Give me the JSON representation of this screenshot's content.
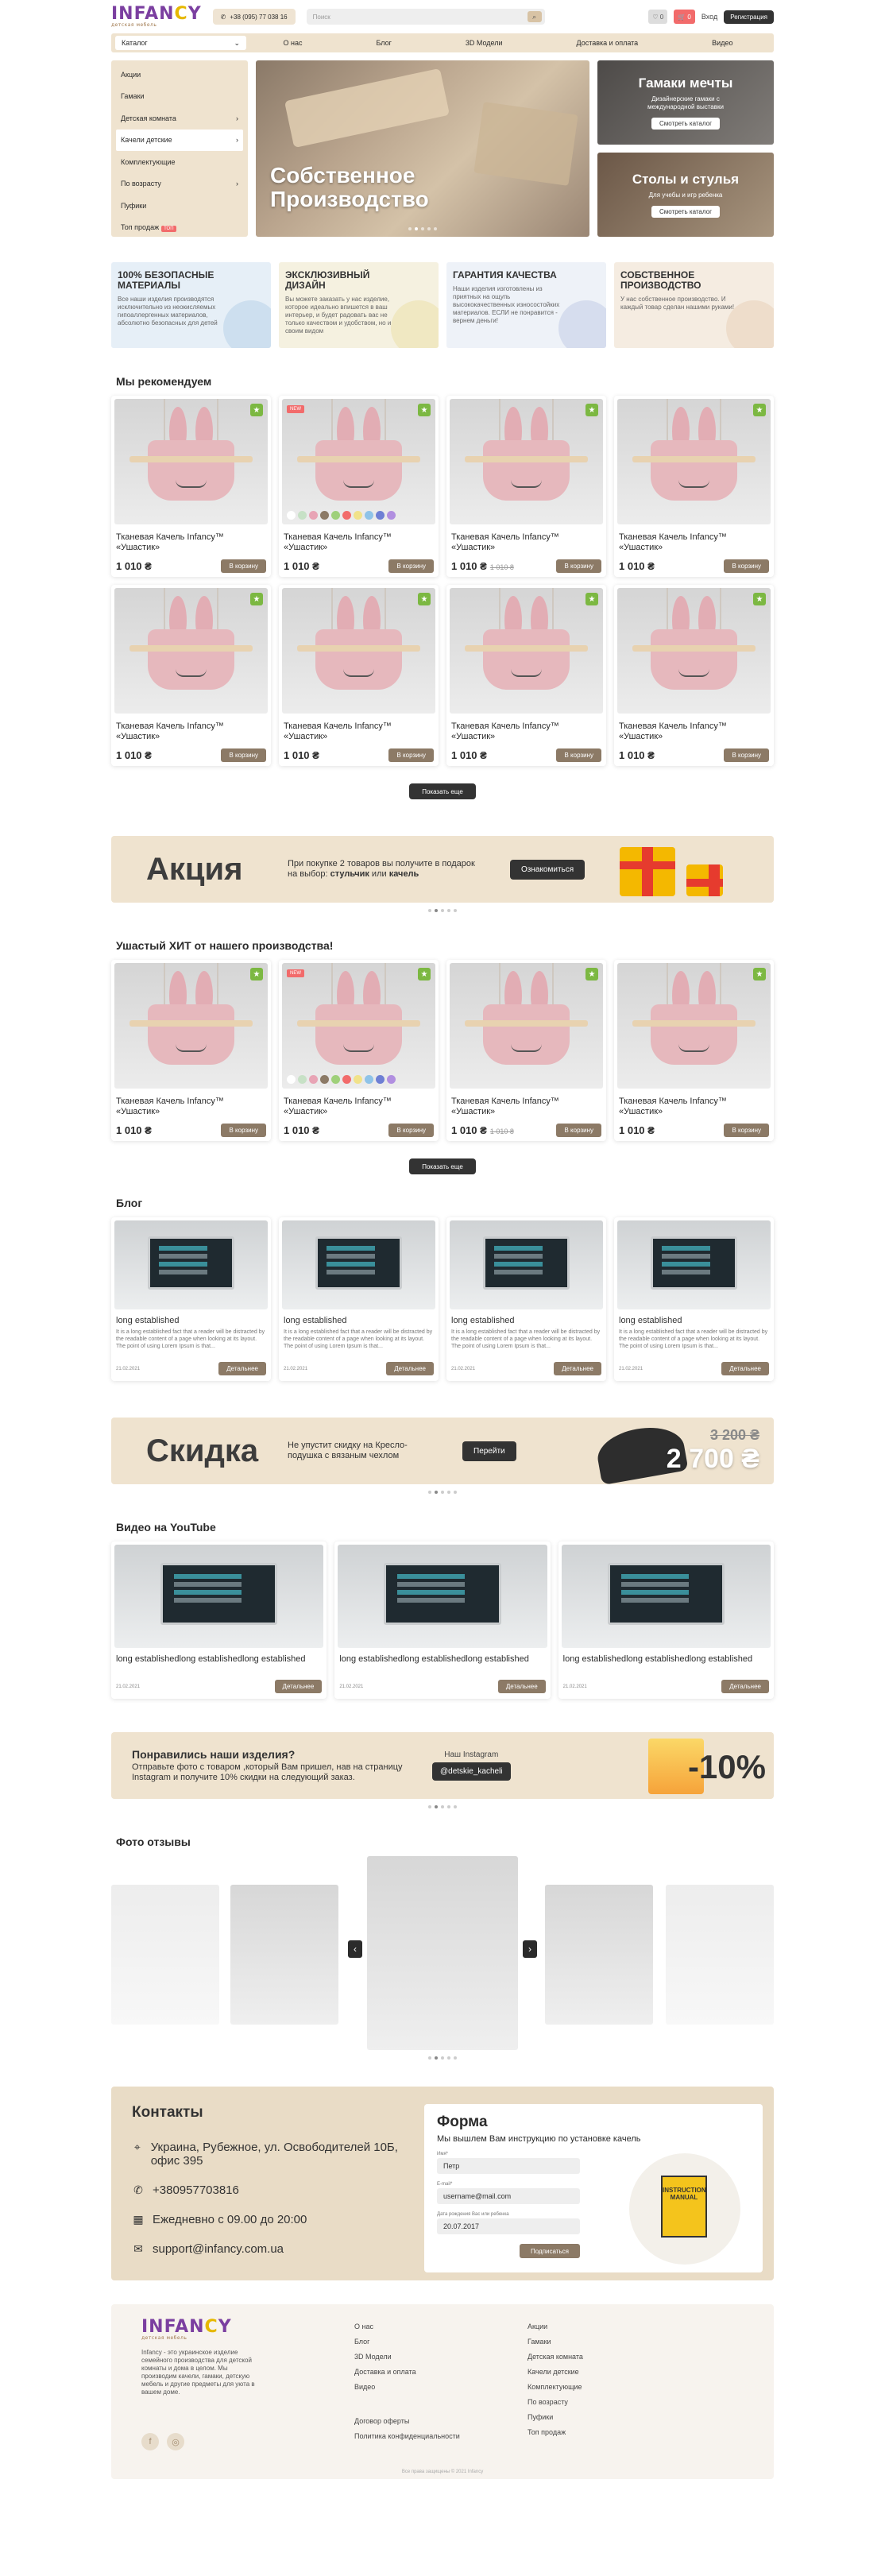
{
  "header": {
    "logo": "INFANCY",
    "logo_sub": "детская мебель",
    "phone": "+38 (095) 77 038 16",
    "search_placeholder": "Поиск",
    "fav_count": "0",
    "cart_count": "0",
    "login": "Вход",
    "register": "Регистрация"
  },
  "nav": {
    "catalog": "Каталог",
    "items": [
      "О нас",
      "Блог",
      "3D Модели",
      "Доставка и оплата",
      "Видео"
    ]
  },
  "sidebar": {
    "items": [
      "Акции",
      "Гамаки",
      "Детская комната",
      "Качели детские",
      "Комплектующие",
      "По возрасту",
      "Пуфики",
      "Топ продаж"
    ],
    "top_badge": "ТОП"
  },
  "hero": {
    "title_line1": "Собственное",
    "title_line2": "Производство",
    "promo1_title": "Гамаки мечты",
    "promo1_text": "Дизайнерские гамаки с международной выставки",
    "promo1_btn": "Смотреть каталог",
    "promo2_title": "Столы и стулья",
    "promo2_text": "Для учебы и игр ребенка",
    "promo2_btn": "Смотреть каталог"
  },
  "features": [
    {
      "title": "100% безопасные материалы",
      "text": "Все наши изделия производятся исключительно из неокисляемых гипоаллергенных материалов, абсолютно безопасных для детей"
    },
    {
      "title": "Эксклюзивный дизайн",
      "text": "Вы можете заказать у нас изделие, которое идеально впишется в ваш интерьер, и будет радовать вас не только качеством и удобством, но и своим видом"
    },
    {
      "title": "Гарантия качества",
      "text": "Наши изделия изготовлены из приятных на ощупь высококачественных износостойких материалов. ЕСЛИ не понравится - вернем деньги!"
    },
    {
      "title": "Собственное производство",
      "text": "У нас собственное производство. И каждый товар сделан нашими руками!"
    }
  ],
  "recommended": {
    "title": "Мы рекомендуем",
    "products": [
      {
        "name": "Тканевая Качель Infancy™ «Ушастик»",
        "price": "1 010 ₴",
        "old": "",
        "new_tag": false,
        "swatches": false
      },
      {
        "name": "Тканевая Качель Infancy™ «Ушастик»",
        "price": "1 010 ₴",
        "old": "",
        "new_tag": true,
        "swatches": true
      },
      {
        "name": "Тканевая Качель Infancy™ «Ушастик»",
        "price": "1 010 ₴",
        "old": "1 010 ₴",
        "new_tag": false,
        "swatches": false
      },
      {
        "name": "Тканевая Качель Infancy™ «Ушастик»",
        "price": "1 010 ₴",
        "old": "",
        "new_tag": false,
        "swatches": false
      },
      {
        "name": "Тканевая Качель Infancy™ «Ушастик»",
        "price": "1 010 ₴",
        "old": "",
        "new_tag": false,
        "swatches": false
      },
      {
        "name": "Тканевая Качель Infancy™ «Ушастик»",
        "price": "1 010 ₴",
        "old": "",
        "new_tag": false,
        "swatches": false
      },
      {
        "name": "Тканевая Качель Infancy™ «Ушастик»",
        "price": "1 010 ₴",
        "old": "",
        "new_tag": false,
        "swatches": false
      },
      {
        "name": "Тканевая Качель Infancy™ «Ушастик»",
        "price": "1 010 ₴",
        "old": "",
        "new_tag": false,
        "swatches": false
      }
    ],
    "cart_btn": "В корзину",
    "more_btn": "Показать еще"
  },
  "promo_action": {
    "title": "Акция",
    "text1": "При покупке 2 товаров вы получите в подарок на выбор:",
    "text_b1": "стульчик",
    "text_or": "или",
    "text_b2": "качель",
    "btn": "Ознакомиться"
  },
  "hit": {
    "title": "Ушастый ХИТ от нашего производства!",
    "products": [
      {
        "name": "Тканевая Качель Infancy™ «Ушастик»",
        "price": "1 010 ₴",
        "old": "",
        "new_tag": false,
        "swatches": false
      },
      {
        "name": "Тканевая Качель Infancy™ «Ушастик»",
        "price": "1 010 ₴",
        "old": "",
        "new_tag": true,
        "swatches": true
      },
      {
        "name": "Тканевая Качель Infancy™ «Ушастик»",
        "price": "1 010 ₴",
        "old": "1 010 ₴",
        "new_tag": false,
        "swatches": false
      },
      {
        "name": "Тканевая Качель Infancy™ «Ушастик»",
        "price": "1 010 ₴",
        "old": "",
        "new_tag": false,
        "swatches": false
      }
    ]
  },
  "blog": {
    "title": "Блог",
    "posts": [
      {
        "title": "long established",
        "text": "It is a long established fact that a reader will be distracted by the readable content of a page when looking at its layout. The point of using Lorem Ipsum is that...",
        "date": "21.02.2021"
      },
      {
        "title": "long established",
        "text": "It is a long established fact that a reader will be distracted by the readable content of a page when looking at its layout. The point of using Lorem Ipsum is that...",
        "date": "21.02.2021"
      },
      {
        "title": "long established",
        "text": "It is a long established fact that a reader will be distracted by the readable content of a page when looking at its layout. The point of using Lorem Ipsum is that...",
        "date": "21.02.2021"
      },
      {
        "title": "long established",
        "text": "It is a long established fact that a reader will be distracted by the readable content of a page when looking at its layout. The point of using Lorem Ipsum is that...",
        "date": "21.02.2021"
      }
    ],
    "details_btn": "Детальнее"
  },
  "sale": {
    "title": "Скидка",
    "text": "Не упустит скидку на Кресло-подушка с вязаным чехлом",
    "btn": "Перейти",
    "old_price": "3 200 ₴",
    "new_price": "2 700 ₴"
  },
  "youtube": {
    "title": "Видео на YouTube",
    "videos": [
      {
        "title": "long establishedlong establishedlong established",
        "date": "21.02.2021"
      },
      {
        "title": "long establishedlong establishedlong established",
        "date": "21.02.2021"
      },
      {
        "title": "long establishedlong establishedlong established",
        "date": "21.02.2021"
      }
    ]
  },
  "instagram": {
    "title": "Понравились наши изделия?",
    "text": "Отправьте фото с товаром ,который Вам пришел, нав на страницу Instagram и получите 10% скидки на следующий заказ.",
    "label": "Наш Instagram",
    "tag": "@detskie_kacheli",
    "percent": "-10%"
  },
  "reviews": {
    "title": "Фото отзывы"
  },
  "contacts": {
    "title": "Контакты",
    "address": "Украина, Рубежное, ул. Освободителей 10Б, офис 395",
    "phone": "+380957703816",
    "hours": "Ежедневно с 09.00 до 20:00",
    "email": "support@infancy.com.ua"
  },
  "form": {
    "title": "Форма",
    "subtitle": "Мы вышлем Вам инструкцию по установке качель",
    "name_label": "Имя*",
    "name_value": "Петр",
    "email_label": "E-mail*",
    "email_value": "username@mail.com",
    "dob_label": "Дата рождения Вас или ребенка",
    "dob_value": "20.07.2017",
    "submit": "Подписаться",
    "manual_text": "INSTRUCTION MANUAL"
  },
  "footer": {
    "about": "Infancy - это украинское изделие семейного производства для детской комнаты и дома в целом. Мы производим качели, гамаки, детскую мебель и другие предметы для уюта в вашем доме.",
    "col1": [
      "О нас",
      "Блог",
      "3D Модели",
      "Доставка и оплата",
      "Видео"
    ],
    "col1b": [
      "Договор оферты",
      "Политика конфиденциальности"
    ],
    "col2": [
      "Акции",
      "Гамаки",
      "Детская комната",
      "Качели детские",
      "Комплектующие",
      "По возрасту",
      "Пуфики",
      "Топ продаж"
    ],
    "copyright": "Все права защищены © 2021 Infancy"
  }
}
